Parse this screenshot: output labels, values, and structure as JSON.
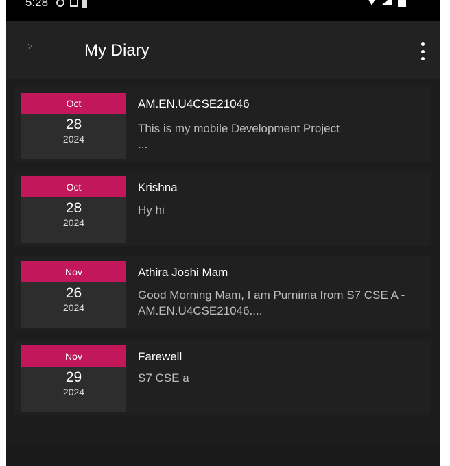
{
  "status_bar": {
    "time": "5:28"
  },
  "app_bar": {
    "title": "My Diary"
  },
  "entries": [
    {
      "month": "Oct",
      "day": "28",
      "year": "2024",
      "title": "AM.EN.U4CSE21046",
      "body": "This is my mobile Development Project\n..."
    },
    {
      "month": "Oct",
      "day": "28",
      "year": "2024",
      "title": "Krishna",
      "body": "Hy hi"
    },
    {
      "month": "Nov",
      "day": "26",
      "year": "2024",
      "title": "Athira Joshi Mam",
      "body": "Good Morning Mam, I am Purnima from S7 CSE A - AM.EN.U4CSE21046...."
    },
    {
      "month": "Nov",
      "day": "29",
      "year": "2024",
      "title": "Farewell",
      "body": "S7 CSE a"
    }
  ],
  "colors": {
    "accent": "#c2185b",
    "background": "#1c1c1c",
    "card": "#202020"
  },
  "icons": [
    "settings-icon",
    "vpn-key-icon",
    "sim-card-icon",
    "wifi-icon",
    "signal-icon",
    "battery-icon",
    "overflow-menu-icon"
  ]
}
